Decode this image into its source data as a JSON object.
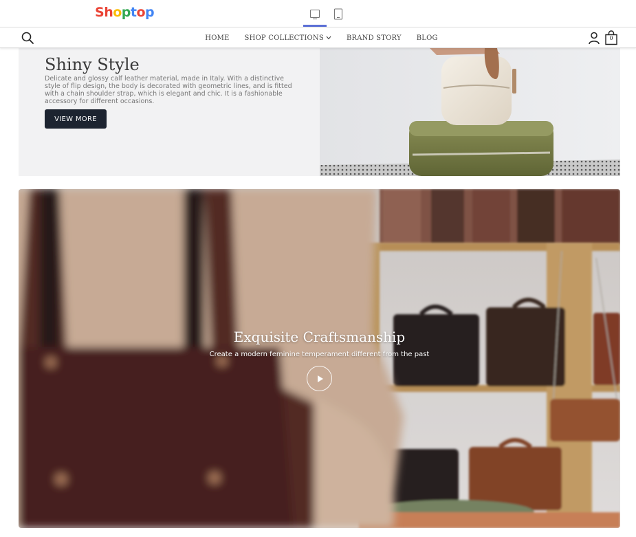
{
  "preview_bar": {
    "logo_letters": [
      {
        "char": "S",
        "color": "#ea4335"
      },
      {
        "char": "h",
        "color": "#ea4335"
      },
      {
        "char": "o",
        "color": "#fbbc05"
      },
      {
        "char": "p",
        "color": "#34a853"
      },
      {
        "char": "t",
        "color": "#4285f4"
      },
      {
        "char": "o",
        "color": "#ea4335"
      },
      {
        "char": "p",
        "color": "#4285f4"
      }
    ],
    "devices": [
      {
        "name": "desktop-icon",
        "active": true
      },
      {
        "name": "tablet-icon",
        "active": false
      }
    ],
    "accent_color": "#5b6fd6"
  },
  "nav": {
    "links": [
      "HOME",
      "SHOP COLLECTIONS",
      "BRAND STORY",
      "BLOG"
    ],
    "cart_count": "0",
    "icons": [
      "search-icon",
      "chevron-down-icon",
      "account-icon",
      "cart-icon"
    ]
  },
  "hero": {
    "title": "Shiny Style",
    "description": "Delicate and glossy calf leather material, made in Italy. With a distinctive style of flip design, the body is decorated with geometric lines, and is fitted with a chain shoulder strap, which is elegant and chic. It is a fashionable accessory for different occasions.",
    "button_label": "VIEW MORE",
    "button_color": "#1d2430"
  },
  "video": {
    "title": "Exquisite Craftsmanship",
    "subtitle": "Create a modern feminine temperament different from the past",
    "icons": [
      "play-icon"
    ]
  }
}
